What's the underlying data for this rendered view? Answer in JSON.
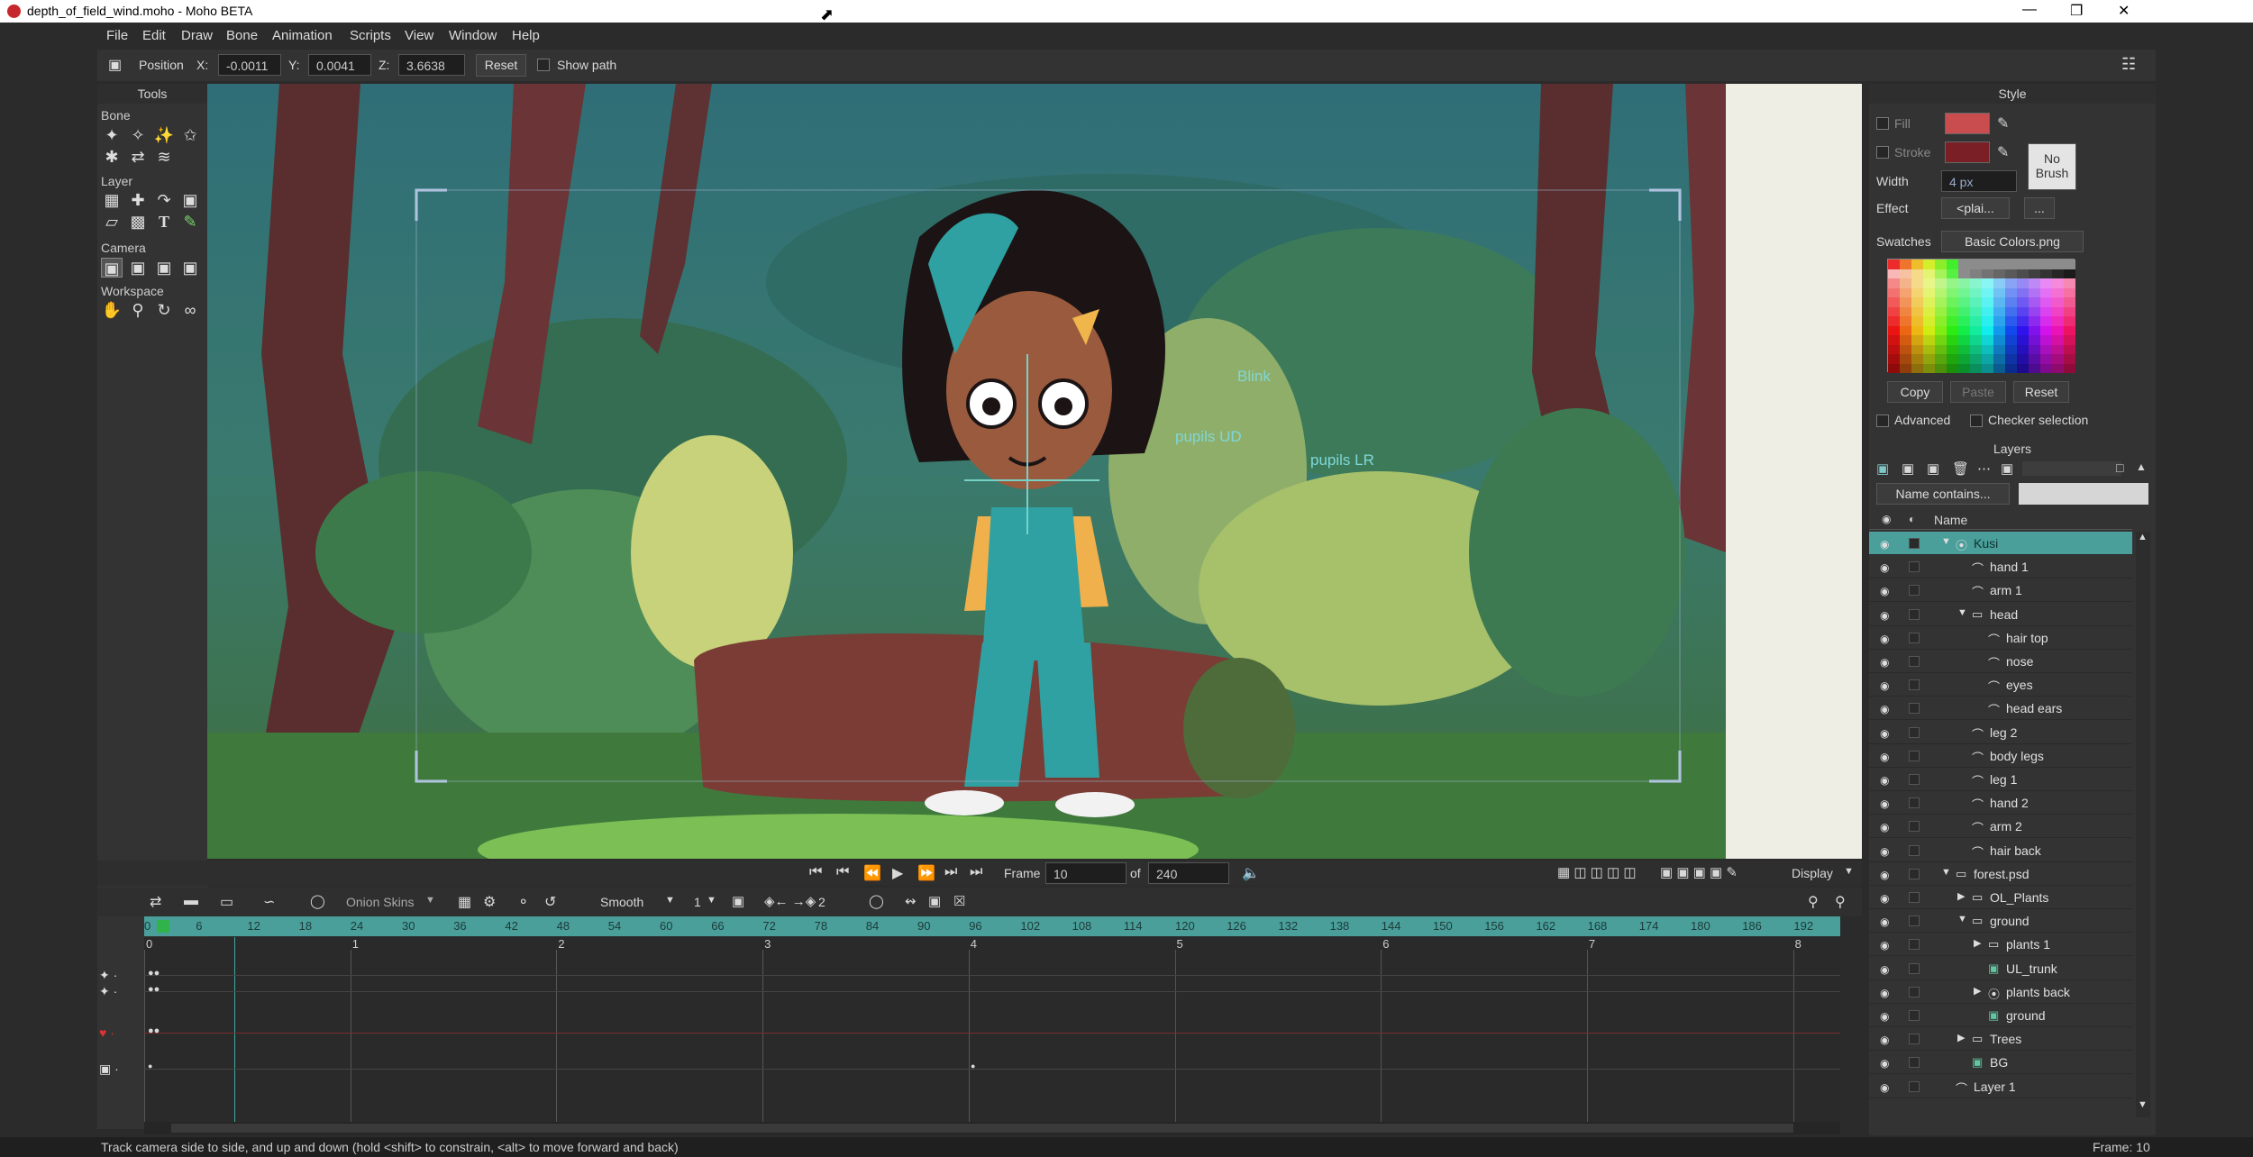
{
  "window": {
    "title": "depth_of_field_wind.moho - Moho BETA"
  },
  "menu": [
    "File",
    "Edit",
    "Draw",
    "Bone",
    "Animation",
    "Scripts",
    "View",
    "Window",
    "Help"
  ],
  "options": {
    "tool_label": "Position",
    "x_label": "X:",
    "x_value": "-0.0011",
    "y_label": "Y:",
    "y_value": "0.0041",
    "z_label": "Z:",
    "z_value": "3.6638",
    "reset_label": "Reset",
    "show_path_label": "Show path"
  },
  "tools": {
    "title": "Tools",
    "sections": [
      "Bone",
      "Layer",
      "Camera",
      "Workspace"
    ]
  },
  "canvas": {
    "bone_labels": [
      "Blink",
      "pupils UD",
      "pupils LR"
    ]
  },
  "transport": {
    "frame_label": "Frame",
    "frame_value": "10",
    "of_label": "of",
    "total_frames": "240",
    "display_label": "Display"
  },
  "timeline": {
    "onion_skins_label": "Onion Skins",
    "interp_label": "Smooth",
    "interp_count": "1",
    "keys_count": "2",
    "ruler_ticks": [
      "0",
      "6",
      "12",
      "18",
      "24",
      "30",
      "36",
      "42",
      "48",
      "54",
      "60",
      "66",
      "72",
      "78",
      "84",
      "90",
      "96",
      "102",
      "108",
      "114",
      "120",
      "126",
      "132",
      "138",
      "144",
      "150",
      "156",
      "162",
      "168",
      "174",
      "180",
      "186",
      "192"
    ],
    "seconds": [
      "0",
      "1",
      "2",
      "3",
      "4",
      "5",
      "6",
      "7",
      "8"
    ],
    "current_frame": 10
  },
  "status": {
    "hint": "Track camera side to side, and up and down (hold <shift> to constrain, <alt> to move forward and back)",
    "frame": "Frame: 10"
  },
  "style_panel": {
    "title": "Style",
    "fill_label": "Fill",
    "stroke_label": "Stroke",
    "width_label": "Width",
    "width_value": "4 px",
    "effect_label": "Effect",
    "effect_value": "<plai...",
    "effect_more": "...",
    "no_brush_line1": "No",
    "no_brush_line2": "Brush",
    "swatches_label": "Swatches",
    "swatches_value": "Basic Colors.png",
    "copy_label": "Copy",
    "paste_label": "Paste",
    "reset_label": "Reset",
    "advanced_label": "Advanced",
    "checker_label": "Checker selection",
    "fill_color": "#c94d4f",
    "stroke_color": "#7a1f26"
  },
  "layers_panel": {
    "title": "Layers",
    "filter_label": "Name contains...",
    "name_header": "Name",
    "rows": [
      {
        "name": "Kusi",
        "depth": 0,
        "type": "bone",
        "expand": "open",
        "selected": true
      },
      {
        "name": "hand 1",
        "depth": 1,
        "type": "vector",
        "expand": "",
        "selected": false
      },
      {
        "name": "arm 1",
        "depth": 1,
        "type": "vector",
        "expand": "",
        "selected": false
      },
      {
        "name": "head",
        "depth": 1,
        "type": "group",
        "expand": "open",
        "selected": false
      },
      {
        "name": "hair top",
        "depth": 2,
        "type": "vector",
        "expand": "",
        "selected": false
      },
      {
        "name": "nose",
        "depth": 2,
        "type": "vector",
        "expand": "",
        "selected": false
      },
      {
        "name": "eyes",
        "depth": 2,
        "type": "vector",
        "expand": "",
        "selected": false
      },
      {
        "name": "head ears",
        "depth": 2,
        "type": "vector",
        "expand": "",
        "selected": false
      },
      {
        "name": "leg 2",
        "depth": 1,
        "type": "vector",
        "expand": "",
        "selected": false
      },
      {
        "name": "body legs",
        "depth": 1,
        "type": "vector",
        "expand": "",
        "selected": false
      },
      {
        "name": "leg 1",
        "depth": 1,
        "type": "vector",
        "expand": "",
        "selected": false
      },
      {
        "name": "hand 2",
        "depth": 1,
        "type": "vector",
        "expand": "",
        "selected": false
      },
      {
        "name": "arm 2",
        "depth": 1,
        "type": "vector",
        "expand": "",
        "selected": false
      },
      {
        "name": "hair back",
        "depth": 1,
        "type": "vector",
        "expand": "",
        "selected": false
      },
      {
        "name": "forest.psd",
        "depth": 0,
        "type": "group",
        "expand": "open",
        "selected": false
      },
      {
        "name": "OL_Plants",
        "depth": 1,
        "type": "group",
        "expand": "closed",
        "selected": false
      },
      {
        "name": "ground",
        "depth": 1,
        "type": "group",
        "expand": "open",
        "selected": false
      },
      {
        "name": "plants 1",
        "depth": 2,
        "type": "group",
        "expand": "closed",
        "selected": false
      },
      {
        "name": "UL_trunk",
        "depth": 2,
        "type": "image",
        "expand": "",
        "selected": false
      },
      {
        "name": "plants back",
        "depth": 2,
        "type": "bone",
        "expand": "closed",
        "selected": false
      },
      {
        "name": "ground",
        "depth": 2,
        "type": "image",
        "expand": "",
        "selected": false
      },
      {
        "name": "Trees",
        "depth": 1,
        "type": "group",
        "expand": "closed",
        "selected": false
      },
      {
        "name": "BG",
        "depth": 1,
        "type": "image",
        "expand": "",
        "selected": false
      },
      {
        "name": "Layer 1",
        "depth": 0,
        "type": "vector",
        "expand": "",
        "selected": false
      }
    ]
  }
}
